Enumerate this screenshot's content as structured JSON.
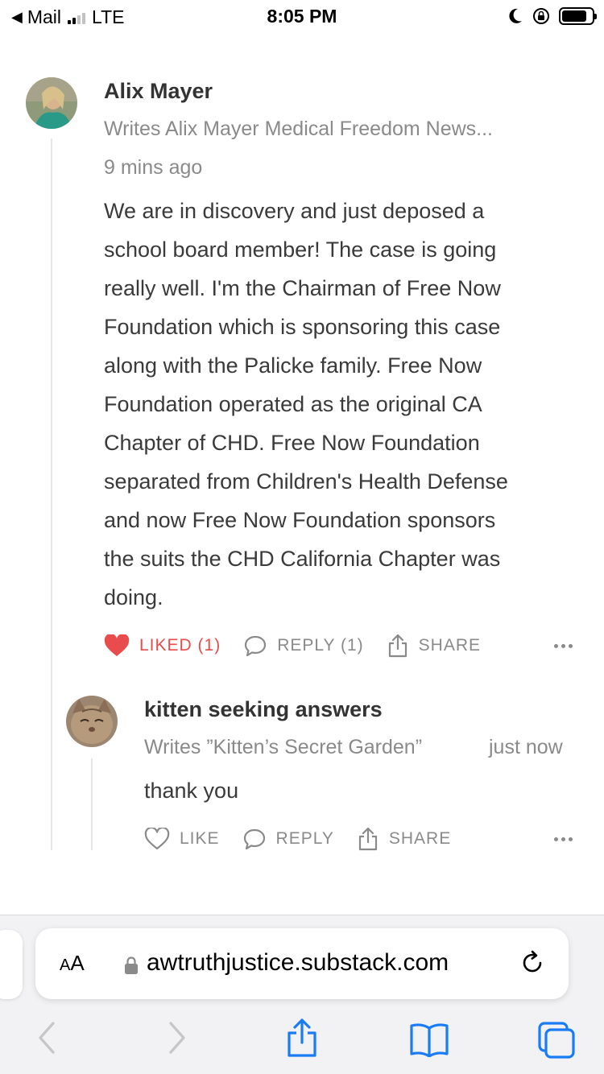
{
  "status_bar": {
    "back_app": "Mail",
    "network": "LTE",
    "time": "8:05 PM"
  },
  "comment": {
    "author": "Alix Mayer",
    "subtitle": "Writes Alix Mayer Medical Freedom News...",
    "time": "9 mins ago",
    "body_lines": [
      "We are in discovery and just deposed a",
      "school board member! The case is going",
      "really well. I'm the Chairman of Free Now",
      "Foundation which is sponsoring this case",
      "along with the Palicke family. Free Now",
      "Foundation operated as the original CA",
      "Chapter of CHD. Free Now Foundation",
      "separated from Children's Health Defense",
      "and now Free Now Foundation sponsors",
      "the suits the CHD California Chapter was",
      "doing."
    ],
    "actions": {
      "like": "LIKED (1)",
      "reply": "REPLY (1)",
      "share": "SHARE"
    }
  },
  "reply": {
    "author": "kitten seeking answers",
    "subtitle": "Writes ”Kitten’s Secret Garden”",
    "time": "just now",
    "body": "thank you",
    "actions": {
      "like": "LIKE",
      "reply": "REPLY",
      "share": "SHARE"
    }
  },
  "browser": {
    "text_size_label_small": "A",
    "text_size_label_large": "A",
    "url": "awtruthjustice.substack.com"
  },
  "colors": {
    "liked": "#e84c4c",
    "safari_blue": "#1a7cf5",
    "muted": "#8a8a8a"
  }
}
